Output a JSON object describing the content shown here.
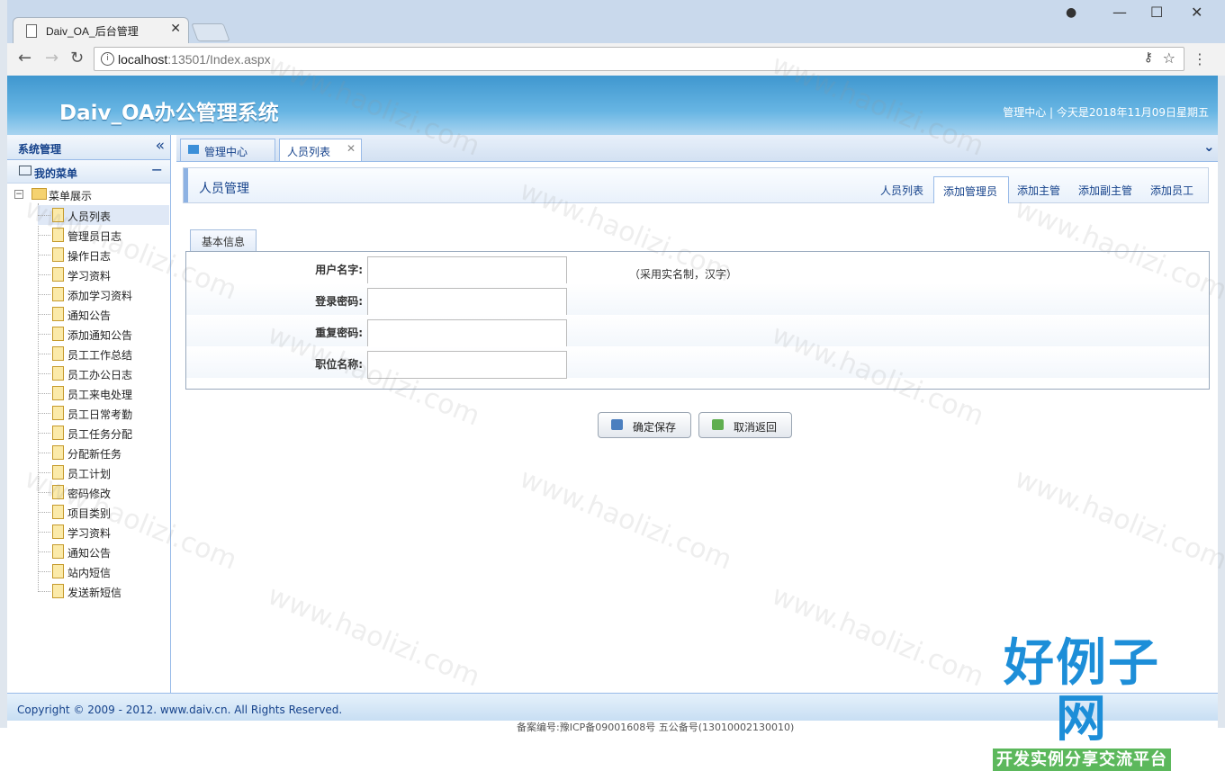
{
  "browser": {
    "tab_title": "Daiv_OA_后台管理",
    "url_host": "localhost",
    "url_rest": ":13501/Index.aspx"
  },
  "header": {
    "logo": "Daiv_OA办公管理系统",
    "right_text": "管理中心 | 今天是2018年11月09日星期五"
  },
  "sidebar": {
    "title": "系统管理",
    "menu_title": "我的菜单",
    "root_label": "菜单展示",
    "items": [
      {
        "label": "人员列表"
      },
      {
        "label": "管理员日志"
      },
      {
        "label": "操作日志"
      },
      {
        "label": "学习资料"
      },
      {
        "label": "添加学习资料"
      },
      {
        "label": "通知公告"
      },
      {
        "label": "添加通知公告"
      },
      {
        "label": "员工工作总结"
      },
      {
        "label": "员工办公日志"
      },
      {
        "label": "员工来电处理"
      },
      {
        "label": "员工日常考勤"
      },
      {
        "label": "员工任务分配"
      },
      {
        "label": "分配新任务"
      },
      {
        "label": "员工计划"
      },
      {
        "label": "密码修改"
      },
      {
        "label": "项目类别"
      },
      {
        "label": "学习资料"
      },
      {
        "label": "通知公告"
      },
      {
        "label": "站内短信"
      },
      {
        "label": "发送新短信"
      }
    ]
  },
  "main_tabs": [
    {
      "label": "管理中心"
    },
    {
      "label": "人员列表"
    }
  ],
  "panel": {
    "title": "人员管理",
    "subtabs": [
      {
        "label": "人员列表"
      },
      {
        "label": "添加管理员"
      },
      {
        "label": "添加主管"
      },
      {
        "label": "添加副主管"
      },
      {
        "label": "添加员工"
      }
    ]
  },
  "form": {
    "tab_label": "基本信息",
    "fields": [
      {
        "label": "用户名字:",
        "value": "",
        "hint": "（采用实名制，汉字）"
      },
      {
        "label": "登录密码:",
        "value": ""
      },
      {
        "label": "重复密码:",
        "value": ""
      },
      {
        "label": "职位名称:",
        "value": ""
      }
    ],
    "save_label": "确定保存",
    "cancel_label": "取消返回"
  },
  "footer": {
    "copyright": "Copyright © 2009 - 2012. www.daiv.cn. All Rights Reserved.",
    "icp": "备案编号:豫ICP备09001608号 五公备号(13010002130010)"
  },
  "watermark": {
    "text": "www.haolizi.com",
    "brand_big": "好例子网",
    "brand_small": "开发实例分享交流平台"
  }
}
